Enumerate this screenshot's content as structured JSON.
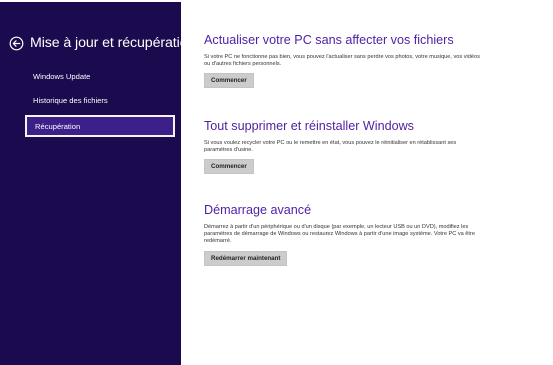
{
  "sidebar": {
    "title": "Mise à jour et récupération",
    "back_icon": "back-arrow-icon",
    "search_icon": "search-icon",
    "items": [
      {
        "label": "Windows Update",
        "selected": false
      },
      {
        "label": "Historique des fichiers",
        "selected": false
      },
      {
        "label": "Récupération",
        "selected": true
      }
    ]
  },
  "sections": [
    {
      "title": "Actualiser votre PC sans affecter vos fichiers",
      "description": "Si votre PC ne fonctionne pas bien, vous pouvez l'actualiser sans perdre vos photos, votre musique, vos vidéos ou d'autres fichiers personnels.",
      "button": "Commencer"
    },
    {
      "title": "Tout supprimer et réinstaller Windows",
      "description": "Si vous voulez recycler votre PC ou le remettre en état, vous pouvez le réinitialiser en rétablissant ses paramètres d'usine.",
      "button": "Commencer"
    },
    {
      "title": "Démarrage avancé",
      "description": "Démarrez à partir d'un périphérique ou d'un disque (par exemple, un lecteur USB ou un DVD), modifiez les paramètres de démarrage de Windows ou restaurez Windows à partir d'une image système. Votre PC va être redémarré.",
      "button": "Redémarrer maintenant"
    }
  ],
  "colors": {
    "sidebar_bg": "#1b0a4e",
    "selected_bg": "#3d1f8a",
    "accent": "#4f1fa5",
    "button_bg": "#cccccc"
  }
}
